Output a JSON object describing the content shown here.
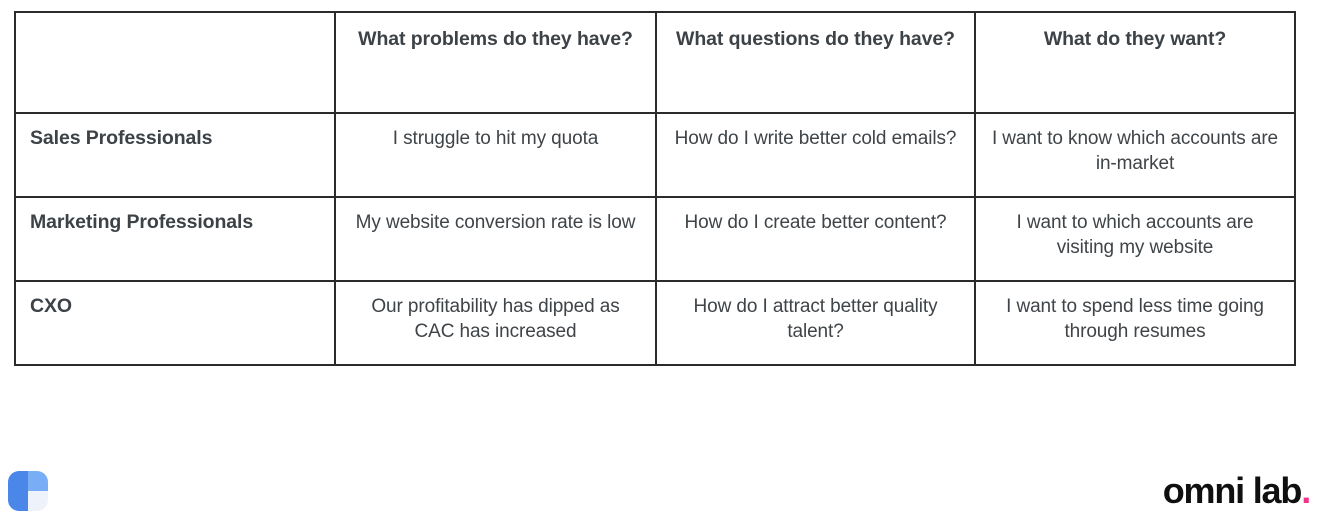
{
  "table": {
    "columns": [
      {
        "key": "persona",
        "label": ""
      },
      {
        "key": "problems",
        "label": "What problems do they have?"
      },
      {
        "key": "questions",
        "label": "What questions do they have?"
      },
      {
        "key": "wants",
        "label": "What do they want?"
      }
    ],
    "rows": [
      {
        "persona": "Sales Professionals",
        "problems": "I struggle to hit my quota",
        "questions": "How do I write better cold emails?",
        "wants": "I want to know which accounts are in-market"
      },
      {
        "persona": "Marketing Professionals",
        "problems": "My website conversion rate is low",
        "questions": "How do I create better content?",
        "wants": "I want to which accounts are visiting my website"
      },
      {
        "persona": "CXO",
        "problems": "Our profitability has dipped as CAC has increased",
        "questions": "How do I attract better quality talent?",
        "wants": "I want to spend less time going through resumes"
      }
    ]
  },
  "brand": {
    "logo_icon": "omnilab-square-logo-icon",
    "wordmark": "omni lab",
    "wordmark_dot": ".",
    "colors": {
      "logo_blue_dark": "#4a87e8",
      "logo_blue_light": "#79aef7",
      "logo_pale": "#eef3fb",
      "wordmark_text": "#0f0f0f",
      "wordmark_dot": "#f0338d",
      "table_border": "#2b2b2b",
      "text": "#3f4448"
    }
  }
}
